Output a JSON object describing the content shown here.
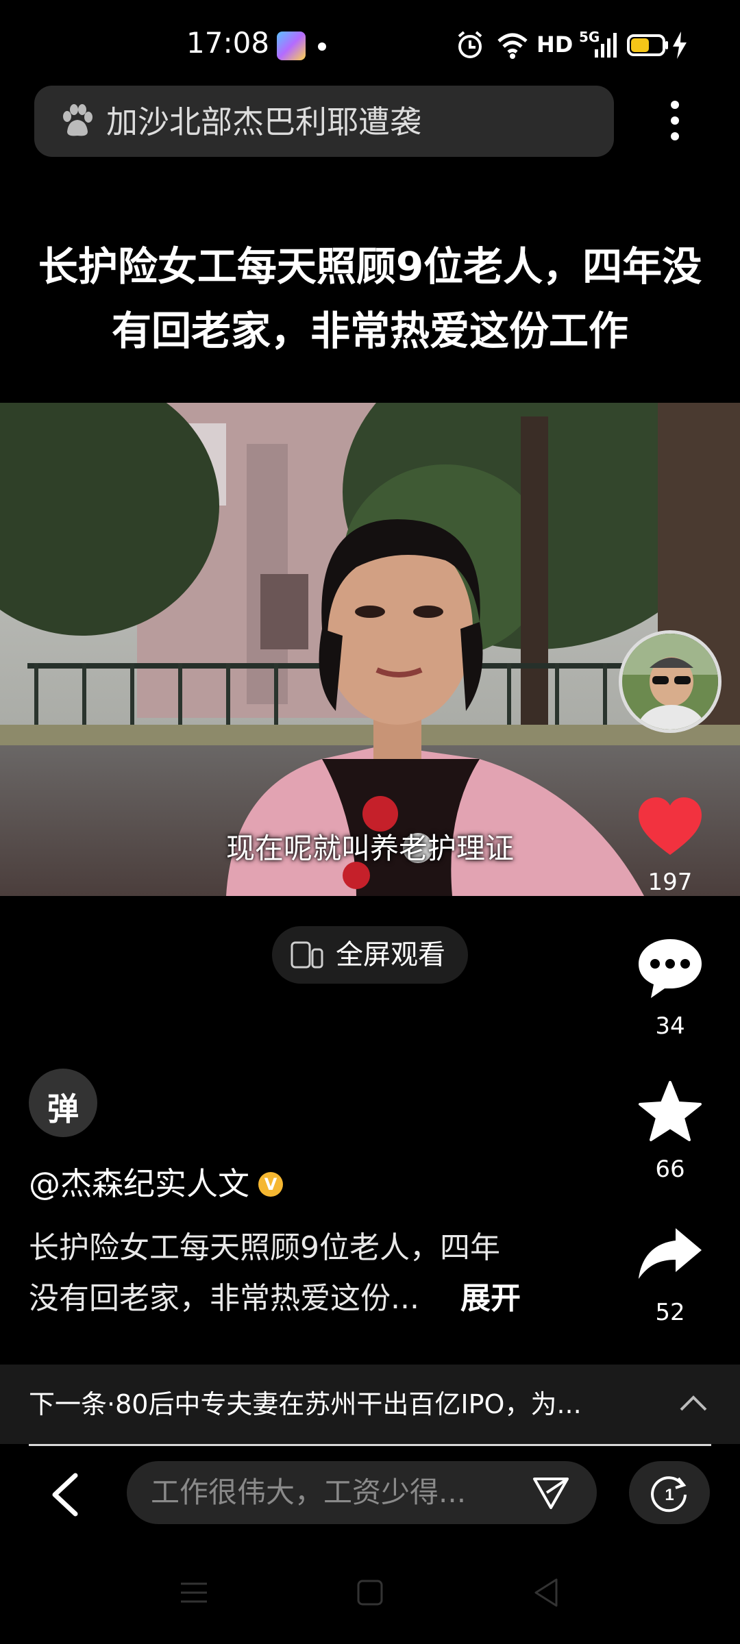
{
  "status_bar": {
    "time": "17:08",
    "network": "HD",
    "signal_type": "5G",
    "icons": [
      "gallery-app-icon",
      "alarm-icon",
      "wifi-icon",
      "signal-icon",
      "battery-icon",
      "charging-icon"
    ],
    "battery_level": 0.6
  },
  "search": {
    "query": "加沙北部杰巴利耶遭袭",
    "icons": [
      "baidu-paw-icon",
      "more-vert-icon"
    ]
  },
  "video": {
    "title": "长护险女工每天照顾9位老人，四年没有回老家，非常热爱这份工作",
    "subtitle": "现在呢就叫养老护理证",
    "fullscreen_label": "全屏观看"
  },
  "actions": {
    "likes": "197",
    "comments": "34",
    "favorites": "66",
    "shares": "52",
    "like_color": "#f2323f"
  },
  "danmaku": {
    "label": "弹"
  },
  "author": {
    "name": "@杰森纪实人文",
    "verified_badge": "V"
  },
  "description": {
    "line1": "长护险女工每天照顾9位老人，四年",
    "line2": "没有回老家，非常热爱这份...",
    "expand_label": "展开"
  },
  "next": {
    "text": "下一条·80后中专夫妻在苏州干出百亿IPO，为..."
  },
  "bottom_bar": {
    "comment_placeholder": "工作很伟大，工资少得...",
    "pager_label": "1"
  },
  "system_nav": [
    "menu-icon",
    "home-icon",
    "back-triangle-icon"
  ]
}
